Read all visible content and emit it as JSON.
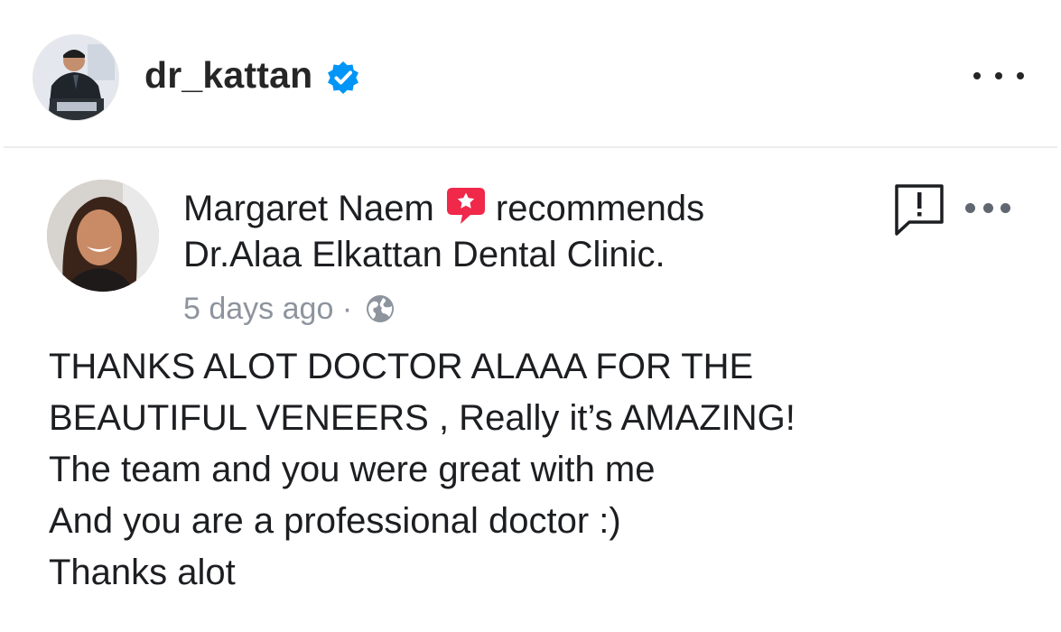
{
  "post": {
    "username": "dr_kattan",
    "verified": true,
    "avatar_icon": "profile-photo",
    "more_icon": "more-horizontal-icon"
  },
  "recommendation": {
    "reviewer_name": "Margaret Naem",
    "verb": "recommends",
    "page_name": "Dr.Alaa Elkattan Dental Clinic.",
    "badge_icon": "recommendation-star-bubble-icon",
    "badge_color": "#f0284a",
    "time_ago": "5 days ago",
    "separator": "·",
    "privacy_icon": "globe-icon",
    "report_icon": "report-icon",
    "review_lines": [
      "THANKS ALOT DOCTOR ALAAA FOR THE",
      "BEAUTIFUL VENEERS , Really it’s AMAZING!",
      "The team and you were great with me",
      "And you are a professional doctor :)",
      "Thanks alot"
    ]
  },
  "colors": {
    "verified_blue": "#0095f6",
    "text_primary": "#262626",
    "text_secondary": "#8d949e"
  }
}
